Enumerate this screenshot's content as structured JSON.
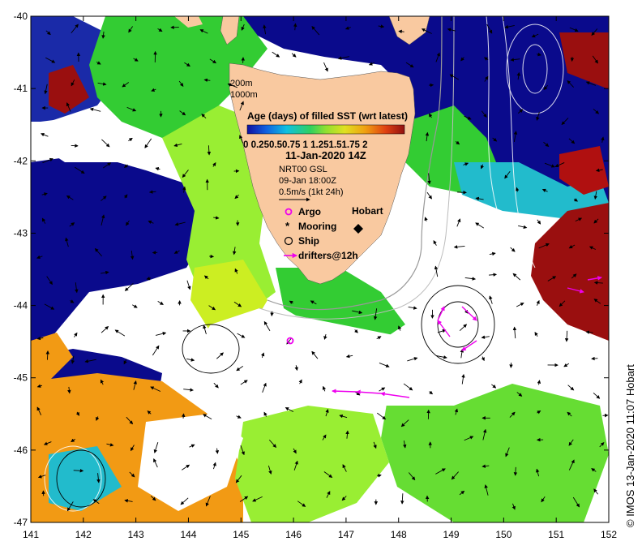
{
  "map": {
    "lon_ticks": [
      "141",
      "142",
      "143",
      "144",
      "145",
      "146",
      "147",
      "148",
      "149",
      "150",
      "151",
      "152"
    ],
    "lat_ticks": [
      "-40",
      "-41",
      "-42",
      "-43",
      "-44",
      "-45",
      "-46",
      "-47"
    ],
    "lon_range": [
      141,
      152
    ],
    "lat_range": [
      -47,
      -40
    ]
  },
  "legend": {
    "depth_200": "200m",
    "depth_1000": "1000m",
    "colorbar_title": "Age (days) of filled SST (wrt latest)",
    "colorbar_ticks": [
      "0",
      "0.25",
      "0.5",
      "0.75",
      "1",
      "1.25",
      "1.5",
      "1.75",
      "2"
    ],
    "colorbar_ticks_text": "0  0.250.50.75  1  1.251.51.75  2",
    "date": "11-Jan-2020 14Z",
    "product": "NRT00 GSL",
    "product_time": "09-Jan 18:00Z",
    "scale": "0.5m/s (1kt 24h)",
    "argo": "Argo",
    "mooring": "Mooring",
    "ship": "Ship",
    "drifters": "drifters@12h"
  },
  "places": {
    "hobart": "Hobart"
  },
  "credit": "© IMOS 13-Jan-2020 11:07 Hobart",
  "colors": {
    "land": "#f9c9a0",
    "deep_blue": "#0a0a8c",
    "dark_red": "#9a0f0f",
    "orange": "#f29a14",
    "green": "#33cc33",
    "lime": "#99ee33",
    "cyan": "#22bbcc",
    "drifter": "#ee00ee"
  }
}
